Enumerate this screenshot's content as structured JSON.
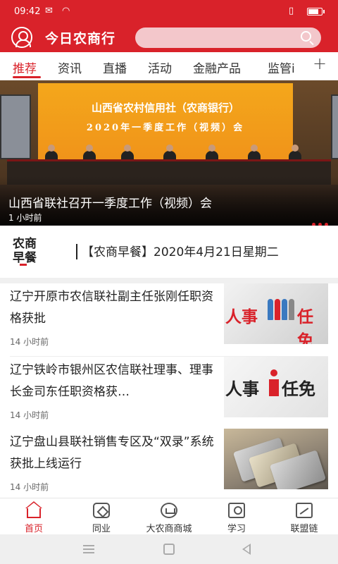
{
  "status_bar": {
    "time": "09:42",
    "icons": [
      "mail-icon",
      "wifi-icon",
      "vibrate-icon",
      "battery-icon"
    ]
  },
  "app_bar": {
    "title": "今日农商行",
    "search_placeholder": ""
  },
  "tabs": [
    {
      "label": "推荐",
      "active": true
    },
    {
      "label": "资讯",
      "active": false
    },
    {
      "label": "直播",
      "active": false
    },
    {
      "label": "活动",
      "active": false
    },
    {
      "label": "金融产品",
      "active": false
    },
    {
      "label": "监管i",
      "active": false
    }
  ],
  "add_tab_label": "+",
  "banner": {
    "screen_line1": "山西省农村信用社（农商银行）",
    "screen_line2": "2020年一季度工作（视频）会",
    "caption": "山西省联社召开一季度工作（视频）会",
    "time": "1 小时前"
  },
  "breakfast": {
    "logo_line1": "农商",
    "logo_line2": "早餐",
    "headline": "【农商早餐】2020年4月21日星期二"
  },
  "news": [
    {
      "title": "辽宁开原市农信联社副主任张刚任职资格获批",
      "time": "14 小时前",
      "thumb_text_a": "人事",
      "thumb_text_b": "任免"
    },
    {
      "title": "辽宁铁岭市银州区农信联社理事、理事长金司东任职资格获…",
      "time": "14 小时前",
      "thumb_text_a": "人事",
      "thumb_text_b": "任免"
    },
    {
      "title": "辽宁盘山县联社销售专区及“双录”系统获批上线运行",
      "time": "14 小时前"
    }
  ],
  "bottom_nav": [
    {
      "label": "首页",
      "icon": "home-icon",
      "active": true
    },
    {
      "label": "同业",
      "icon": "peer-icon",
      "active": false
    },
    {
      "label": "大农商商城",
      "icon": "mall-icon",
      "active": false
    },
    {
      "label": "学习",
      "icon": "learn-icon",
      "active": false
    },
    {
      "label": "联盟链",
      "icon": "chain-icon",
      "active": false
    }
  ],
  "colors": {
    "brand_red": "#d9222a",
    "banner_orange": "#f4a71b"
  }
}
